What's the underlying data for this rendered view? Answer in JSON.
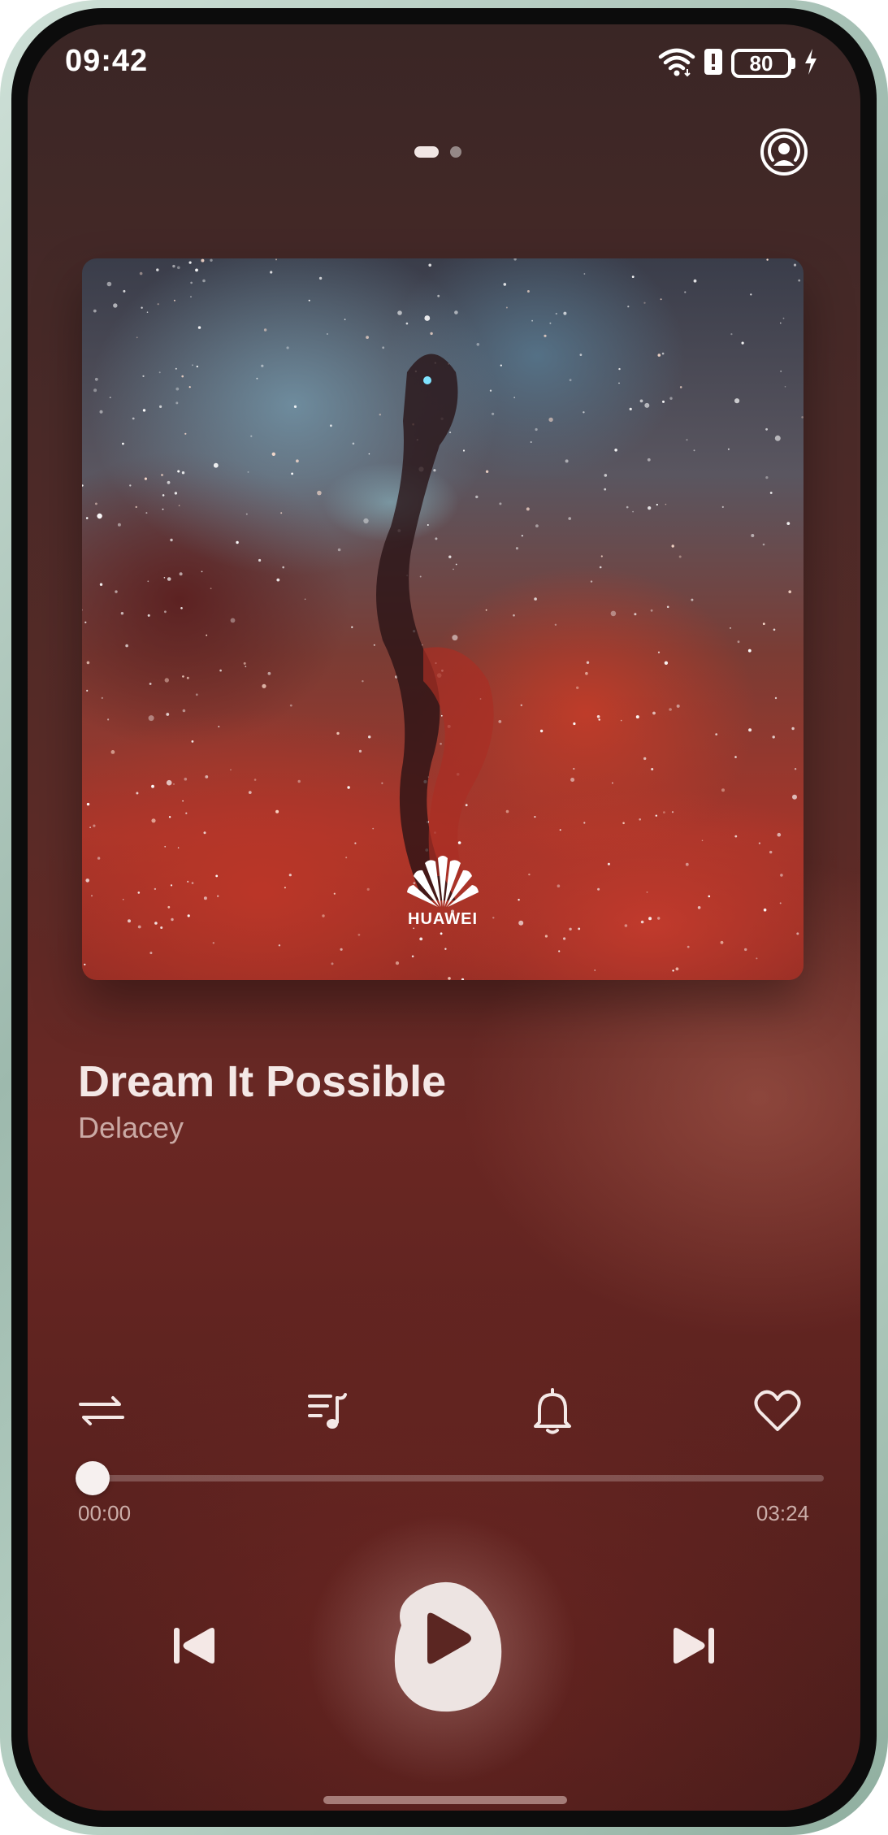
{
  "status_bar": {
    "time": "09:42",
    "battery": "80",
    "icons": [
      "wifi-icon",
      "alert-icon",
      "battery-icon",
      "charging-icon"
    ]
  },
  "header": {
    "page_indicator": {
      "pages": 2,
      "active_index": 0
    },
    "cast_icon": "cast-audio-icon"
  },
  "album": {
    "brand_logo": "huawei-logo",
    "brand_text": "HUAWEI"
  },
  "track": {
    "title": "Dream It Possible",
    "artist": "Delacey"
  },
  "actions": [
    "shuffle-icon",
    "playlist-icon",
    "bell-icon",
    "heart-icon"
  ],
  "progress": {
    "elapsed": "00:00",
    "total": "03:24",
    "fraction": 0.0
  },
  "controls": [
    "previous-icon",
    "play-icon",
    "next-icon"
  ],
  "colors": {
    "background_top": "#3a2625",
    "background_bottom": "#4b1d1b",
    "accent_light": "#f3ebe9",
    "text_primary": "#f4e8e6",
    "frame": "#9db9ad"
  }
}
